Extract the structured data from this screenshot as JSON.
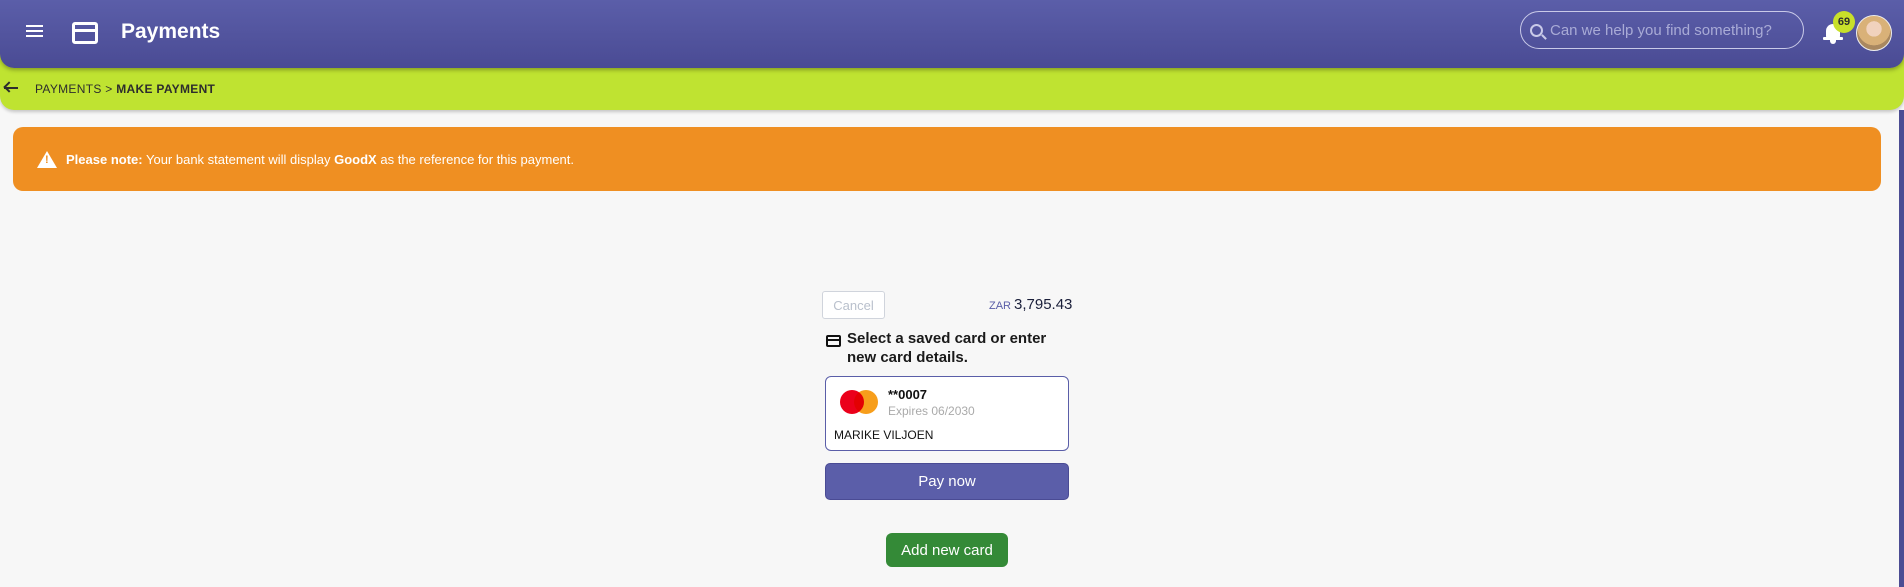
{
  "appbar": {
    "title": "Payments",
    "search_placeholder": "Can we help you find something?",
    "notification_count": "69",
    "icons": {
      "menu": "menu-icon",
      "page": "credit-card-icon",
      "search": "search-icon",
      "bell": "bell-icon"
    }
  },
  "breadcrumb": {
    "parent": "PAYMENTS",
    "separator": ">",
    "current": "MAKE PAYMENT"
  },
  "notice": {
    "label": "Please note:",
    "text_before": "Your bank statement will display",
    "reference": "GoodX",
    "text_after": "as the reference for this payment."
  },
  "payment": {
    "cancel_label": "Cancel",
    "currency": "ZAR",
    "amount": "3,795.43",
    "select_text": "Select a saved card or enter new card details.",
    "saved_card": {
      "brand": "mastercard",
      "number": "**0007",
      "expiry": "Expires 06/2030",
      "holder": "MARIKE VILJOEN"
    },
    "pay_label": "Pay now",
    "add_card_label": "Add new card"
  },
  "colors": {
    "appbar": "#5b5ea9",
    "breadcrumb_bar": "#bfe331",
    "notice": "#ef8f22",
    "pay_button": "#5b5ea9",
    "add_button": "#348a37"
  }
}
